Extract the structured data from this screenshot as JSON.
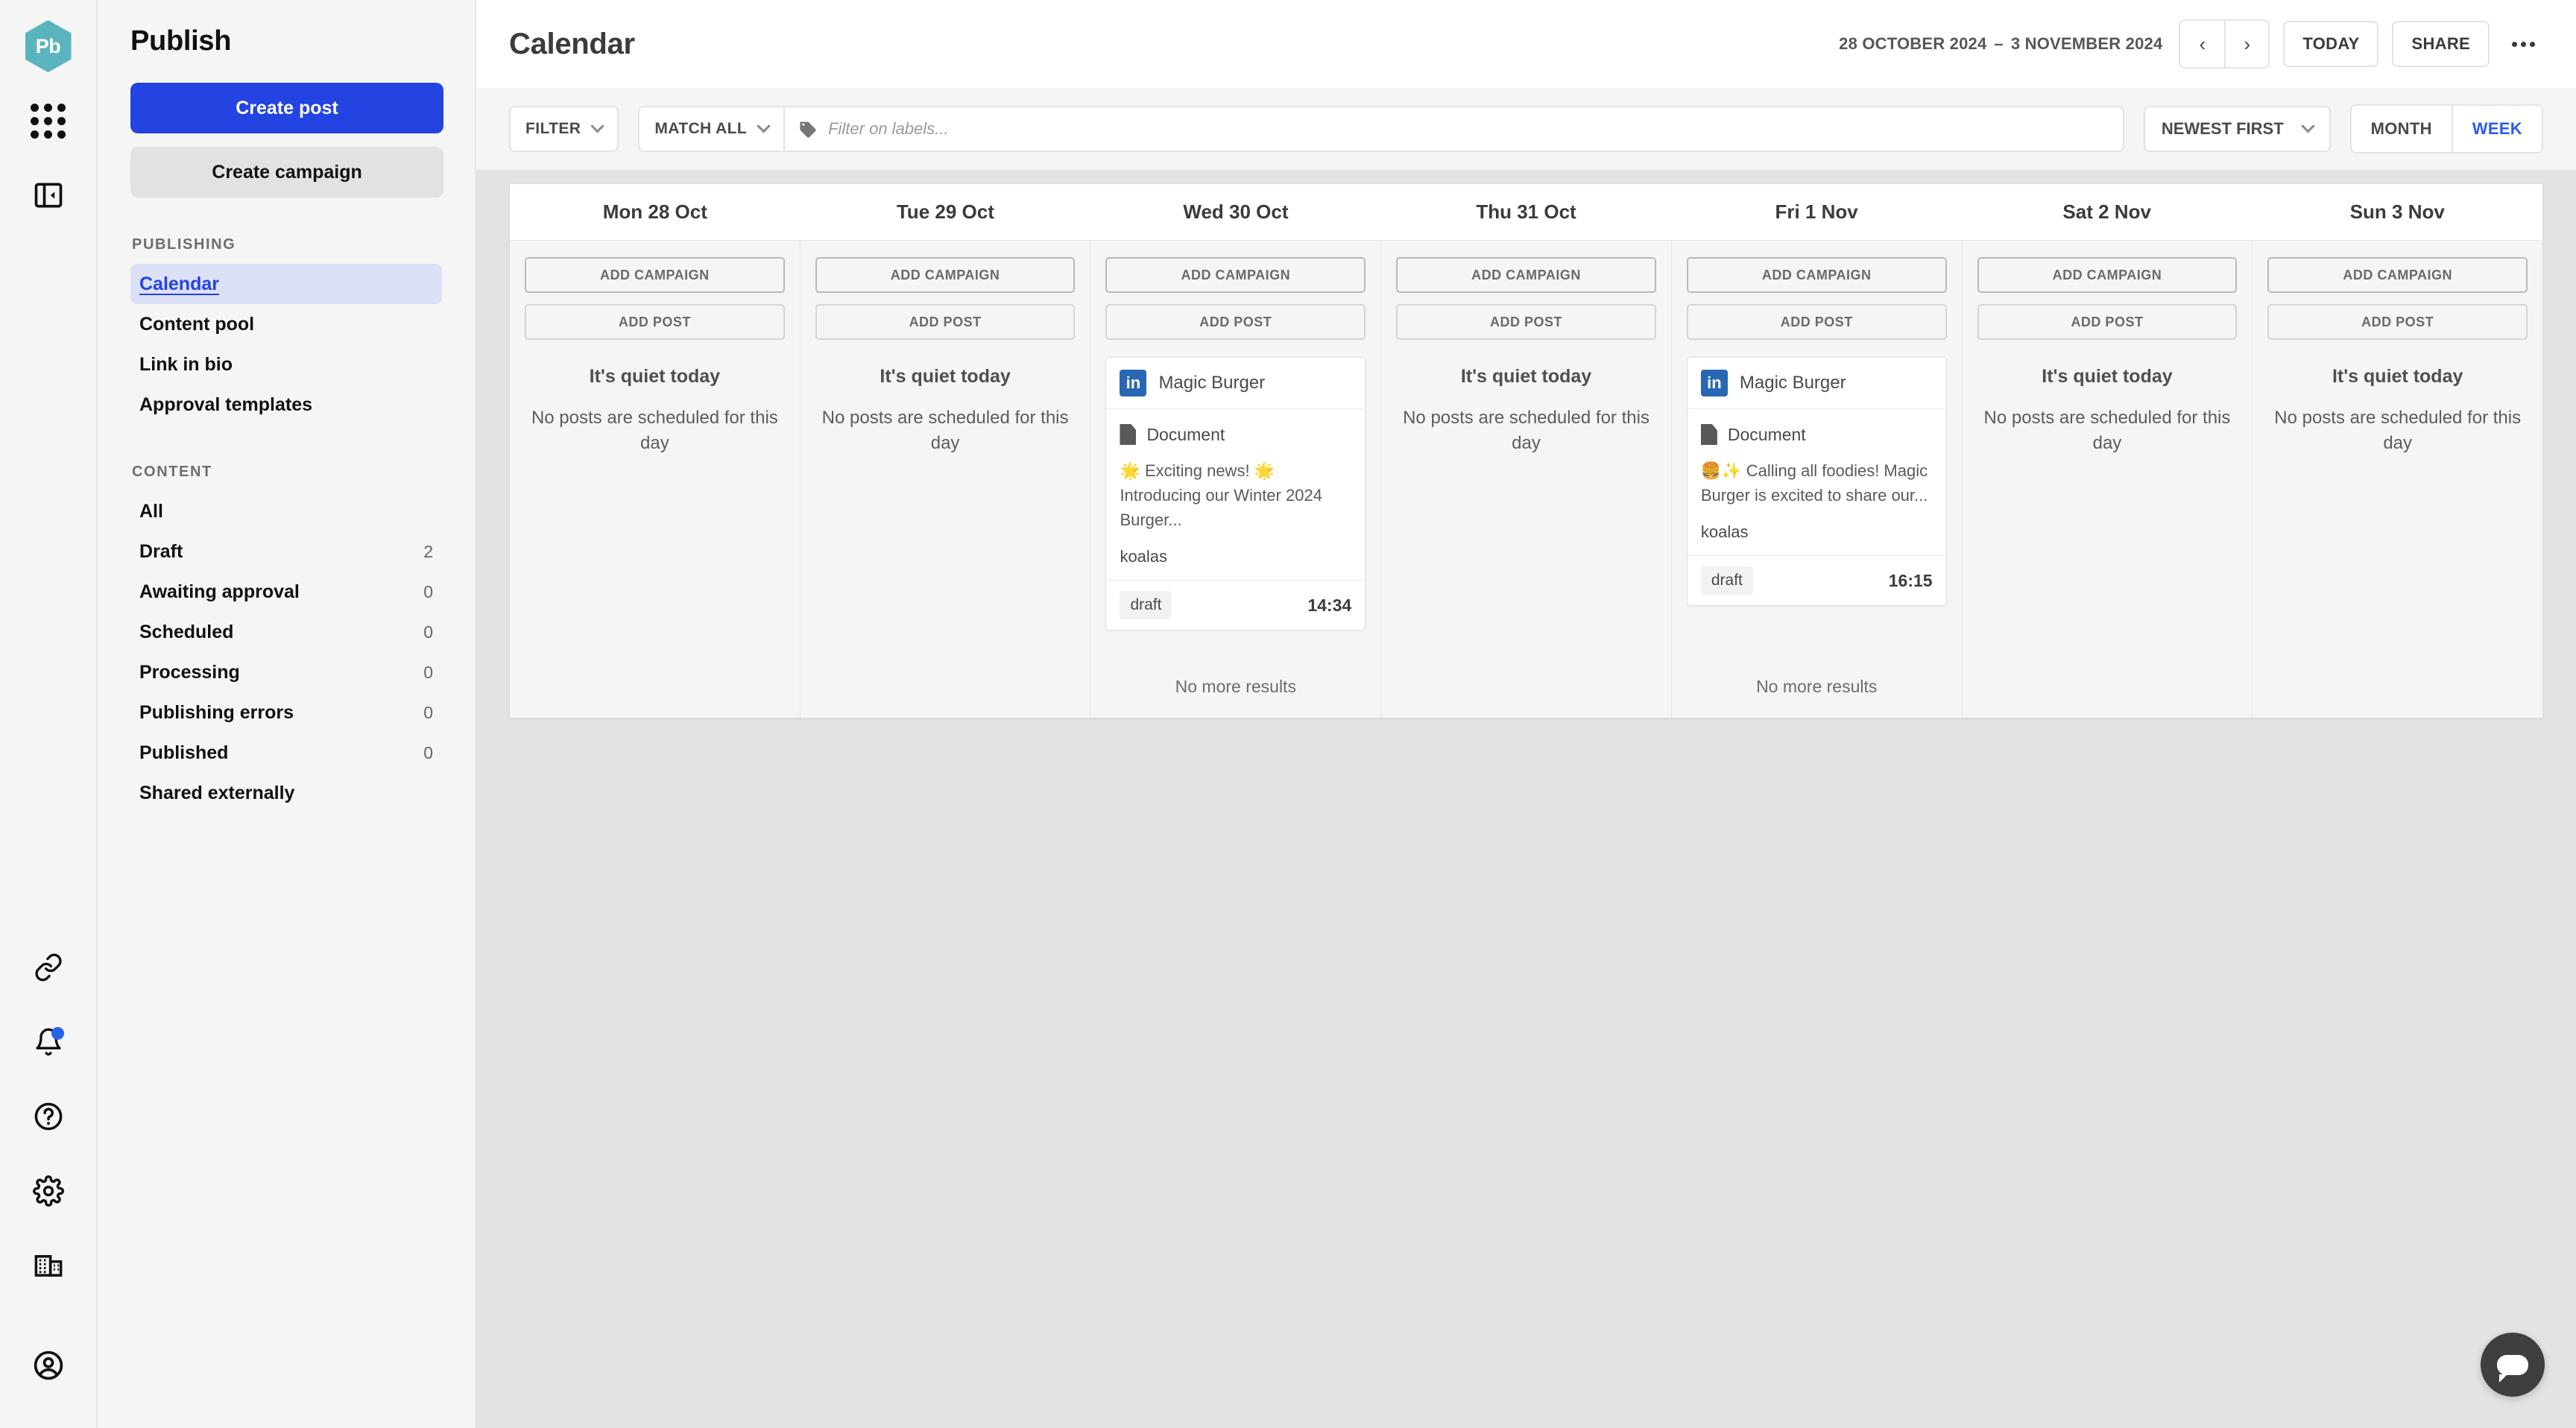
{
  "brand": {
    "logo_text": "Pb",
    "accent": "#2344e0",
    "logo_color": "#5ab4bd"
  },
  "rail": {
    "items": [
      {
        "name": "logo",
        "icon": "pb-logo"
      },
      {
        "name": "apps",
        "icon": "apps-grid-icon"
      },
      {
        "name": "collapse",
        "icon": "collapse-panel-icon"
      }
    ],
    "bottom_items": [
      {
        "name": "link",
        "icon": "link-icon"
      },
      {
        "name": "notifications",
        "icon": "bell-icon",
        "badge": true
      },
      {
        "name": "help",
        "icon": "help-circle-icon"
      },
      {
        "name": "settings",
        "icon": "gear-icon"
      },
      {
        "name": "organisation",
        "icon": "building-icon"
      },
      {
        "name": "account",
        "icon": "user-circle-icon"
      }
    ]
  },
  "sidebar": {
    "title": "Publish",
    "create_post_label": "Create post",
    "create_campaign_label": "Create campaign",
    "sections": [
      {
        "heading": "PUBLISHING",
        "items": [
          {
            "label": "Calendar",
            "count": "",
            "active": true
          },
          {
            "label": "Content pool",
            "count": "",
            "active": false
          },
          {
            "label": "Link in bio",
            "count": "",
            "active": false
          },
          {
            "label": "Approval templates",
            "count": "",
            "active": false
          }
        ]
      },
      {
        "heading": "CONTENT",
        "items": [
          {
            "label": "All",
            "count": "",
            "active": false
          },
          {
            "label": "Draft",
            "count": "2",
            "active": false
          },
          {
            "label": "Awaiting approval",
            "count": "0",
            "active": false
          },
          {
            "label": "Scheduled",
            "count": "0",
            "active": false
          },
          {
            "label": "Processing",
            "count": "0",
            "active": false
          },
          {
            "label": "Publishing errors",
            "count": "0",
            "active": false
          },
          {
            "label": "Published",
            "count": "0",
            "active": false
          },
          {
            "label": "Shared externally",
            "count": "",
            "active": false
          }
        ]
      }
    ]
  },
  "topbar": {
    "title": "Calendar",
    "date_start": "28 OCTOBER 2024",
    "date_dash": "–",
    "date_end": "3 NOVEMBER 2024",
    "prev_label": "‹",
    "next_label": "›",
    "today_label": "TODAY",
    "share_label": "SHARE",
    "more_label": "more-options"
  },
  "filterbar": {
    "filter_label": "FILTER",
    "match_label": "MATCH ALL",
    "labels_placeholder": "Filter on labels...",
    "labels_value": "",
    "sort_label": "NEWEST FIRST",
    "view_month_label": "MONTH",
    "view_week_label": "WEEK",
    "view_active": "WEEK"
  },
  "calendar": {
    "add_campaign_label": "ADD CAMPAIGN",
    "add_post_label": "ADD POST",
    "quiet_title": "It's quiet today",
    "quiet_sub": "No posts are scheduled for this day",
    "no_more_label": "No more results",
    "days": [
      {
        "header": "Mon 28 Oct",
        "empty": true,
        "no_more": false,
        "posts": []
      },
      {
        "header": "Tue 29 Oct",
        "empty": true,
        "no_more": false,
        "posts": []
      },
      {
        "header": "Wed 30 Oct",
        "empty": false,
        "no_more": true,
        "posts": [
          {
            "network": "linkedin",
            "network_glyph": "in",
            "account": "Magic Burger",
            "type": "Document",
            "text": "🌟 Exciting news! 🌟 Introducing our Winter 2024 Burger...",
            "label": "koalas",
            "status": "draft",
            "time": "14:34"
          }
        ]
      },
      {
        "header": "Thu 31 Oct",
        "empty": true,
        "no_more": false,
        "posts": []
      },
      {
        "header": "Fri 1 Nov",
        "empty": false,
        "no_more": true,
        "posts": [
          {
            "network": "linkedin",
            "network_glyph": "in",
            "account": "Magic Burger",
            "type": "Document",
            "text": "🍔✨ Calling all foodies! Magic Burger is excited to share our...",
            "label": "koalas",
            "status": "draft",
            "time": "16:15"
          }
        ]
      },
      {
        "header": "Sat 2 Nov",
        "empty": true,
        "no_more": false,
        "posts": []
      },
      {
        "header": "Sun 3 Nov",
        "empty": true,
        "no_more": false,
        "posts": []
      }
    ]
  },
  "chat": {
    "name": "chat-bubble"
  }
}
